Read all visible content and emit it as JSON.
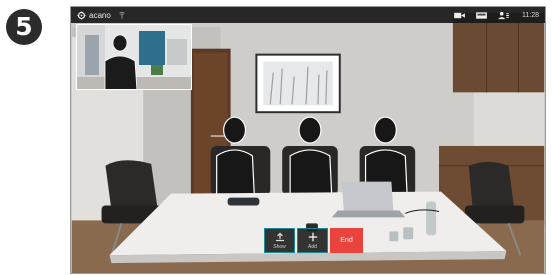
{
  "step": {
    "number": "5"
  },
  "topbar": {
    "brand": "acano",
    "time": "11:28",
    "icons": [
      "settings-icon",
      "signal-icon",
      "camera-icon",
      "layout-icon",
      "participants-icon"
    ]
  },
  "controls": {
    "show_label": "Show",
    "add_label": "Add",
    "end_label": "End"
  },
  "colors": {
    "end_button": "#e8433d",
    "control_border": "#1d8a98",
    "topbar": "#191919"
  }
}
